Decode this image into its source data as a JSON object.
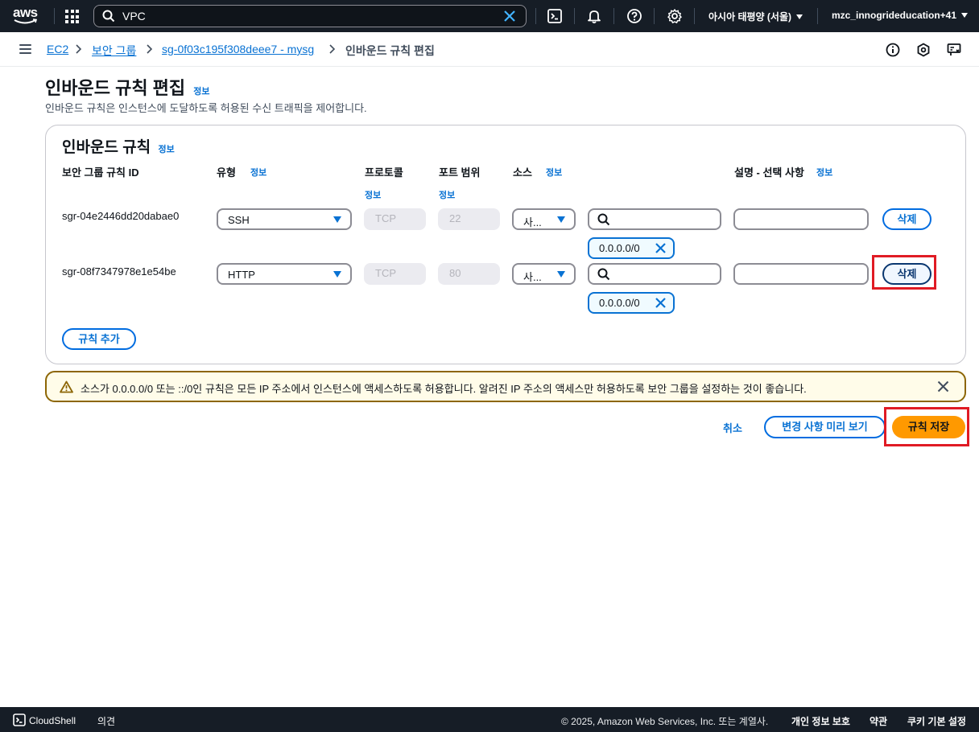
{
  "topnav": {
    "logo": "aws",
    "search_value": "VPC",
    "region": "아시아 태평양 (서울)",
    "account": "mzc_innogrideducation+41",
    "icons": [
      "services-grid-icon",
      "search-icon",
      "clear-icon",
      "cloudshell-icon",
      "notifications-icon",
      "help-icon",
      "settings-icon"
    ]
  },
  "breadcrumb": {
    "items": [
      "EC2",
      "보안 그룹",
      "sg-0f03c195f308deee7 - mysg"
    ],
    "current": "인바운드 규칙 편집"
  },
  "header": {
    "title": "인바운드 규칙 편집",
    "info": "정보",
    "description": "인바운드 규칙은 인스턴스에 도달하도록 허용된 수신 트래픽을 제어합니다."
  },
  "panel": {
    "title": "인바운드 규칙",
    "info": "정보",
    "columns": {
      "rule_id": "보안 그룹 규칙 ID",
      "type": "유형",
      "protocol": "프로토콜",
      "port": "포트 범위",
      "source": "소스",
      "description": "설명 - 선택 사항",
      "info": "정보"
    },
    "rules": [
      {
        "id": "sgr-04e2446dd20dabae0",
        "type": "SSH",
        "protocol": "TCP",
        "port": "22",
        "source": "사...",
        "search_value": "",
        "cidr": "0.0.0.0/0",
        "description": "",
        "delete": "삭제"
      },
      {
        "id": "sgr-08f7347978e1e54be",
        "type": "HTTP",
        "protocol": "TCP",
        "port": "80",
        "source": "사...",
        "search_value": "",
        "cidr": "0.0.0.0/0",
        "description": "",
        "delete": "삭제"
      }
    ],
    "add_rule": "규칙 추가"
  },
  "warning": {
    "message": "소스가 0.0.0.0/0 또는 ::/0인 규칙은 모든 IP 주소에서 인스턴스에 액세스하도록 허용합니다. 알려진 IP 주소의 액세스만 허용하도록 보안 그룹을 설정하는 것이 좋습니다."
  },
  "actions": {
    "cancel": "취소",
    "preview": "변경 사항 미리 보기",
    "save": "규칙 저장"
  },
  "footer": {
    "cloudshell": "CloudShell",
    "feedback": "의견",
    "copyright": "© 2025, Amazon Web Services, Inc. 또는 계열사.",
    "privacy": "개인 정보 보호",
    "terms": "약관",
    "cookies": "쿠키 기본 설정"
  },
  "colors": {
    "nav_bg": "#161d26",
    "link": "#0972d3",
    "primary": "#ff9900",
    "warning_border": "#8d6605",
    "highlight": "#e01b24"
  }
}
